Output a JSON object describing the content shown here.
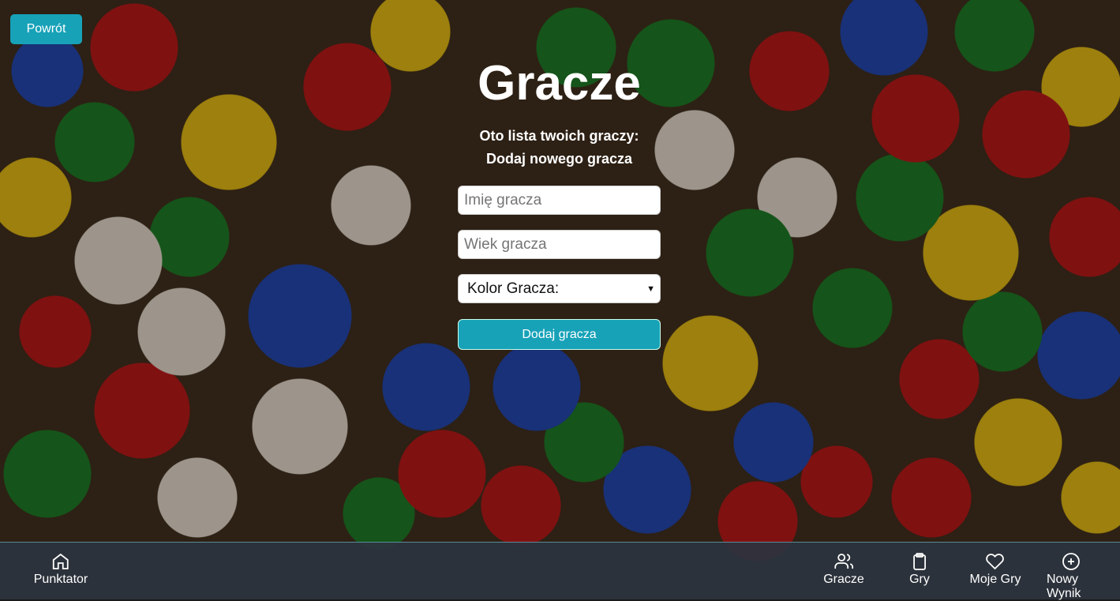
{
  "back_label": "Powrót",
  "title": "Gracze",
  "subtitle": "Oto lista twoich graczy:",
  "add_heading": "Dodaj nowego gracza",
  "form": {
    "name_placeholder": "Imię gracza",
    "age_placeholder": "Wiek gracza",
    "color_select": "Kolor Gracza:",
    "submit": "Dodaj gracza"
  },
  "nav": {
    "home": "Punktator",
    "players": "Gracze",
    "games": "Gry",
    "my_games": "Moje Gry",
    "new_result": "Nowy Wynik"
  },
  "colors": {
    "accent": "#17a2b8",
    "nav_bg": "#2c343e"
  }
}
